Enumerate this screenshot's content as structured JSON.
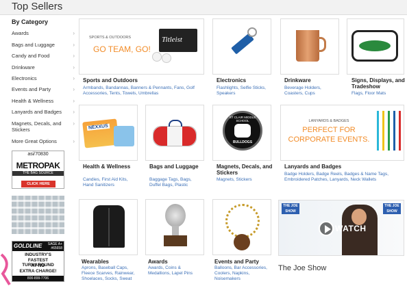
{
  "header": {
    "title": "Top Sellers"
  },
  "sidebar": {
    "title": "By Category",
    "items": [
      {
        "label": "Awards"
      },
      {
        "label": "Bags and Luggage"
      },
      {
        "label": "Candy and Food"
      },
      {
        "label": "Drinkware"
      },
      {
        "label": "Electronics"
      },
      {
        "label": "Events and Party"
      },
      {
        "label": "Health & Wellness"
      },
      {
        "label": "Lanyards and Badges"
      },
      {
        "label": "Magnets, Decals, and Stickers"
      },
      {
        "label": "More Great Options"
      }
    ]
  },
  "ads": {
    "metropak": {
      "asi": "asi/70830",
      "brand": "METROPAK",
      "tagline": "THE BAG SOURCE",
      "cta": "CLICK HERE"
    },
    "goldline": {
      "name": "GOLDLINE",
      "sage": "SAGE A+ #65658",
      "line1": "INDUSTRY'S",
      "line2": "FASTEST TURNAROUND",
      "line3": "AT NO",
      "line4": "EXTRA CHARGE!",
      "phone": "800-899-7706"
    }
  },
  "categories": [
    {
      "title": "Sports and Outdoors",
      "sub": "Armbands, Bandannas, Banners & Pennants, Fans, Golf Accessories, Tents, Towels, Umbrellas",
      "banner_label": "SPORTS & OUTDOORS",
      "banner_text": "GO TEAM, GO!",
      "brand": "Titleist"
    },
    {
      "title": "Electronics",
      "sub": "Flashlights, Selfie Sticks, Speakers"
    },
    {
      "title": "Drinkware",
      "sub": "Beverage Holders, Coasters, Cups"
    },
    {
      "title": "Signs, Displays, and Tradeshow",
      "sub": "Flags, Floor Mats"
    },
    {
      "title": "Health & Wellness",
      "sub": "Candies, First Aid Kits, Hand Sanitizers",
      "brand": "NEXXUS"
    },
    {
      "title": "Bags and Luggage",
      "sub": "Baggage Tags, Bags, Duffel Bags, Plastic"
    },
    {
      "title": "Magnets, Decals, and Stickers",
      "sub": "Magnets, Stickers",
      "magnet_text": "ST CLAIR MIDDLE SCHOOL",
      "magnet_mascot": "BULLDOGS"
    },
    {
      "title": "Lanyards and Badges",
      "sub": "Badge Holders, Badge Reels, Badges & Name Tags, Embroidered Patches, Lanyards, Neck Wallets",
      "banner_label": "LANYARDS & BADGES",
      "banner_text1": "PERFECT FOR",
      "banner_text2": "CORPORATE EVENTS."
    },
    {
      "title": "Wearables",
      "sub": "Aprons, Baseball Caps, Fleece Scarves, Rainwear, Shoelaces, Socks, Sweat"
    },
    {
      "title": "Awards",
      "sub": "Awards, Coins & Medallions, Lapel Pins"
    },
    {
      "title": "Events and Party",
      "sub": "Balloons, Bar Accessories, Coolers, Napkins, Noisemakers"
    }
  ],
  "joe": {
    "title": "The Joe Show",
    "watch": "WATCH",
    "logo1": "THE JOE SHOW",
    "logo2": "THE JOE SHOW"
  },
  "colors": {
    "link": "#3b6fb6",
    "accent_orange": "#f28c28",
    "header_bg": "#f2f2f2"
  }
}
